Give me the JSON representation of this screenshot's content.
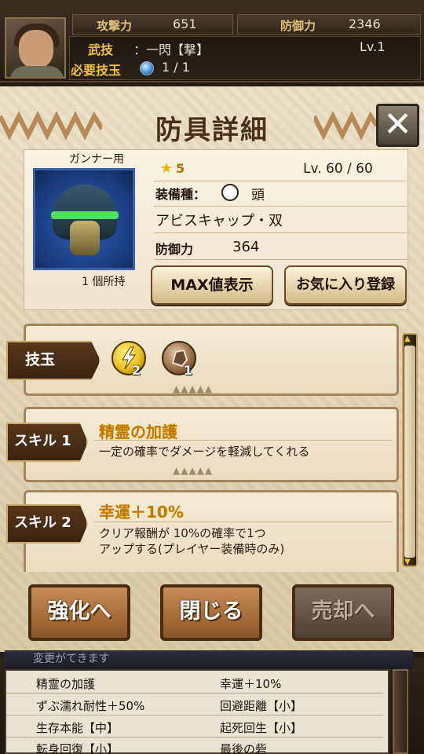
{
  "top": {
    "attack_label": "攻撃力",
    "attack_value": "651",
    "defense_label": "防御力",
    "defense_value": "2346",
    "art_label": "武技",
    "art_value": "：一閃【撃】",
    "art_level": "Lv.1",
    "req_label": "必要技玉",
    "req_value": "1 / 1"
  },
  "modal": {
    "title": "防具詳細",
    "close_glyph": "✕",
    "gunner_label": "ガンナー用",
    "owned": "1 個所持",
    "rarity": "5",
    "level": "Lv. 60 / 60",
    "slot_label": "装備種：",
    "part": "頭",
    "armor_name": "アビスキャップ・双",
    "defense_label": "防御力",
    "defense_value": "364",
    "max_button": "MAX値表示",
    "favorite_button": "お気に入り登録"
  },
  "panel": {
    "gem_tab": "技玉",
    "gems": [
      {
        "icon": "lightning-gem-icon",
        "count": "2",
        "color": "#e8c020"
      },
      {
        "icon": "rock-gem-icon",
        "count": "1",
        "color": "#9a6e4a"
      }
    ],
    "skills": [
      {
        "tab": "スキル 1",
        "name": "精霊の加護",
        "desc": "一定の確率でダメージを軽減してくれる"
      },
      {
        "tab": "スキル 2",
        "name": "幸運＋10%",
        "desc1": "クリア報酬が 10%の確率で1つ",
        "desc2": "アップする(プレイヤー装備時のみ)"
      }
    ]
  },
  "actions": {
    "enhance": "強化へ",
    "close": "閉じる",
    "sell": "売却へ"
  },
  "bottom": {
    "header": "変更がてきます",
    "rows": [
      [
        "精霊の加護",
        "幸運＋10%"
      ],
      [
        "ずぶ濡れ耐性＋50%",
        "回避距離【小】"
      ],
      [
        "生存本能【中】",
        "起死回生【小】"
      ],
      [
        "転身回復【小】",
        "最後の砦"
      ]
    ]
  },
  "colors": {
    "accent": "#f0c040",
    "title": "#4a3018"
  }
}
